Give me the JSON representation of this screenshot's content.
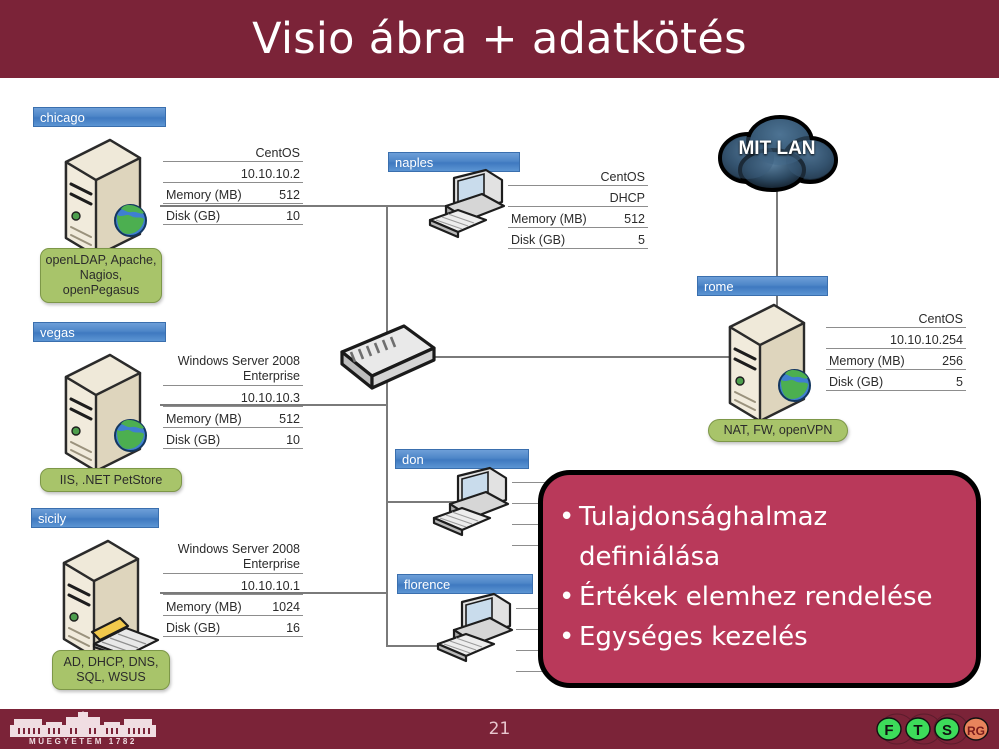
{
  "header": {
    "title": "Visio ábra + adatkötés"
  },
  "footer": {
    "page_number": "21",
    "logo_text": "MŰEGYETEM 1782",
    "ftsrg": [
      "F",
      "T",
      "S",
      "RG"
    ]
  },
  "colors": {
    "header_band": "#7b2338",
    "node_label_blue": "#4e86c8",
    "green_callout": "#a8c46a",
    "red_callout": "#b9395a",
    "wire": "#7a7a7a"
  },
  "cloud": {
    "label": "MIT LAN"
  },
  "nodes": [
    {
      "id": "chicago",
      "label": "chicago",
      "type": "server",
      "rows": [
        {
          "key": "",
          "value": "CentOS"
        },
        {
          "key": "",
          "value": "10.10.10.2"
        },
        {
          "key": "Memory (MB)",
          "value": "512"
        },
        {
          "key": "Disk (GB)",
          "value": "10"
        }
      ],
      "services": "openLDAP, Apache,\nNagios,\nopenPegasus"
    },
    {
      "id": "vegas",
      "label": "vegas",
      "type": "server",
      "rows": [
        {
          "key": "",
          "value": "Windows Server 2008\nEnterprise"
        },
        {
          "key": "",
          "value": "10.10.10.3"
        },
        {
          "key": "Memory (MB)",
          "value": "512"
        },
        {
          "key": "Disk (GB)",
          "value": "10"
        }
      ],
      "services": "IIS, .NET PetStore"
    },
    {
      "id": "sicily",
      "label": "sicily",
      "type": "server",
      "rows": [
        {
          "key": "",
          "value": "Windows Server 2008\nEnterprise"
        },
        {
          "key": "",
          "value": "10.10.10.1"
        },
        {
          "key": "Memory (MB)",
          "value": "1024"
        },
        {
          "key": "Disk (GB)",
          "value": "16"
        }
      ],
      "services": "AD, DHCP, DNS,\nSQL, WSUS"
    },
    {
      "id": "naples",
      "label": "naples",
      "type": "workstation",
      "rows": [
        {
          "key": "",
          "value": "CentOS"
        },
        {
          "key": "",
          "value": "DHCP"
        },
        {
          "key": "Memory (MB)",
          "value": "512"
        },
        {
          "key": "Disk (GB)",
          "value": "5"
        }
      ],
      "services": ""
    },
    {
      "id": "rome",
      "label": "rome",
      "type": "server",
      "rows": [
        {
          "key": "",
          "value": "CentOS"
        },
        {
          "key": "",
          "value": "10.10.10.254"
        },
        {
          "key": "Memory (MB)",
          "value": "256"
        },
        {
          "key": "Disk (GB)",
          "value": "5"
        }
      ],
      "services": "NAT, FW, openVPN"
    },
    {
      "id": "don",
      "label": "don",
      "type": "workstation",
      "rows": [],
      "services": ""
    },
    {
      "id": "florence",
      "label": "florence",
      "type": "workstation",
      "rows": [],
      "services": ""
    }
  ],
  "callout": {
    "bullets": [
      "Tulajdonsághalmaz definiálása",
      "Értékek elemhez rendelése",
      "Egységes kezelés"
    ]
  }
}
